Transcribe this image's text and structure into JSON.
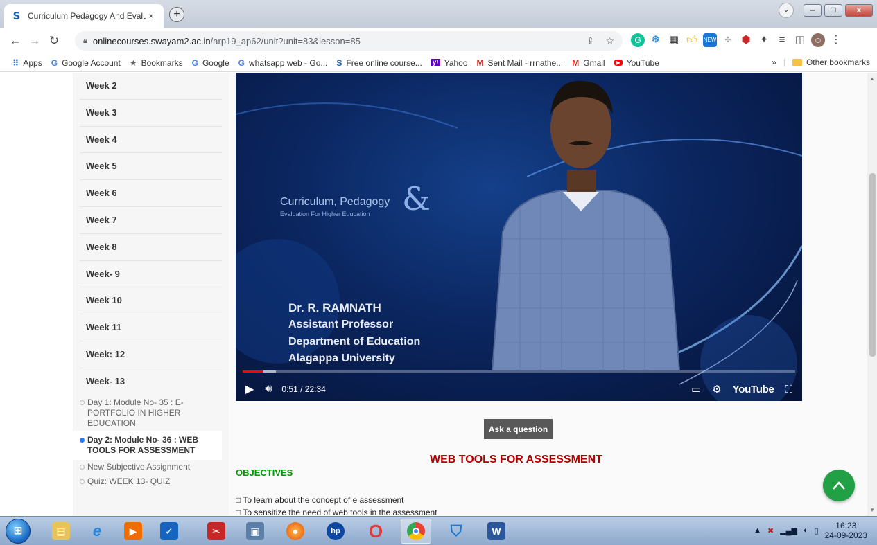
{
  "browser": {
    "tab_title": "Curriculum Pedagogy And Evalua",
    "tab_favicon": "S",
    "tab_close": "×",
    "new_tab": "+",
    "url_host": "onlinecourses.swayam2.ac.in",
    "url_path": "/arp19_ap62/unit?unit=83&lesson=85",
    "window_min": "–",
    "window_max": "□",
    "window_close": "x"
  },
  "bookmarks": [
    {
      "label": "Apps",
      "icon": "apps-grid-icon",
      "glyph": "⋮⋮",
      "color": "#1a73e8"
    },
    {
      "label": "Google Account",
      "icon": "google-icon",
      "glyph": "G",
      "color": "#4285f4"
    },
    {
      "label": "Bookmarks",
      "icon": "star-icon",
      "glyph": "★",
      "color": "#5f6368"
    },
    {
      "label": "Google",
      "icon": "google-icon",
      "glyph": "G",
      "color": "#4285f4"
    },
    {
      "label": "whatsapp web - Go...",
      "icon": "google-icon",
      "glyph": "G",
      "color": "#4285f4"
    },
    {
      "label": "Free online course...",
      "icon": "swayam-icon",
      "glyph": "S",
      "color": "#1a5fb4"
    },
    {
      "label": "Yahoo",
      "icon": "yahoo-icon",
      "glyph": "y!",
      "color": "#6001d2"
    },
    {
      "label": "Sent Mail - rrnathe...",
      "icon": "gmail-icon",
      "glyph": "M",
      "color": "#d93025"
    },
    {
      "label": "Gmail",
      "icon": "gmail-icon",
      "glyph": "M",
      "color": "#d93025"
    },
    {
      "label": "YouTube",
      "icon": "youtube-icon",
      "glyph": "▶",
      "color": "#ff0000"
    }
  ],
  "bookmarks_overflow": "»",
  "other_bookmarks": "Other bookmarks",
  "sidebar": {
    "weeks": [
      "Week 2",
      "Week 3",
      "Week 4",
      "Week 5",
      "Week 6",
      "Week 7",
      "Week 8",
      "Week- 9",
      "Week 10",
      "Week 11",
      "Week: 12",
      "Week- 13"
    ],
    "lessons": [
      {
        "label": "Day 1: Module No- 35 : E-PORTFOLIO IN HIGHER EDUCATION",
        "active": false
      },
      {
        "label": "Day 2: Module No- 36 : WEB TOOLS FOR ASSESSMENT",
        "active": true
      },
      {
        "label": "New Subjective Assignment",
        "active": false
      },
      {
        "label": "Quiz: WEEK 13- QUIZ",
        "active": false
      }
    ]
  },
  "video": {
    "brand_line1": "Curriculum, Pedagogy",
    "brand_line2": "Evaluation For Higher Education",
    "brand_amp": "&",
    "caption": [
      "Dr. R. RAMNATH",
      "Assistant Professor",
      "Department of Education",
      "Alagappa University"
    ],
    "current_time": "0:51",
    "duration": "22:34",
    "progress": 0.038,
    "youtube_label": "YouTube"
  },
  "ask_button": "Ask a question",
  "content": {
    "heading": "WEB TOOLS FOR ASSESSMENT",
    "objectives_title": "OBJECTIVES",
    "objectives": [
      "To learn about the concept of e assessment",
      "To sensitize the need of web tools in the assessment"
    ],
    "bullet_glyph": "□"
  },
  "taskbar": {
    "time": "16:23",
    "date": "24-09-2023"
  },
  "colors": {
    "heading_red": "#b00000",
    "objectives_green": "#009900",
    "progress_red": "#ff0000",
    "scroll_top_green": "#22a046"
  }
}
